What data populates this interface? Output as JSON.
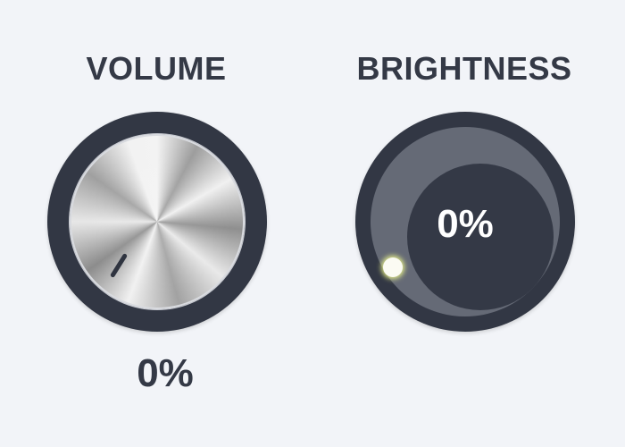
{
  "volume": {
    "label": "VOLUME",
    "value_text": "0%",
    "level": 0
  },
  "brightness": {
    "label": "BRIGHTNESS",
    "value_text": "0%",
    "level": 0
  },
  "colors": {
    "background": "#f2f4f8",
    "text": "#343946",
    "ring": "#323744",
    "track": "#656a76",
    "handle_glow": "#ecf68c"
  }
}
